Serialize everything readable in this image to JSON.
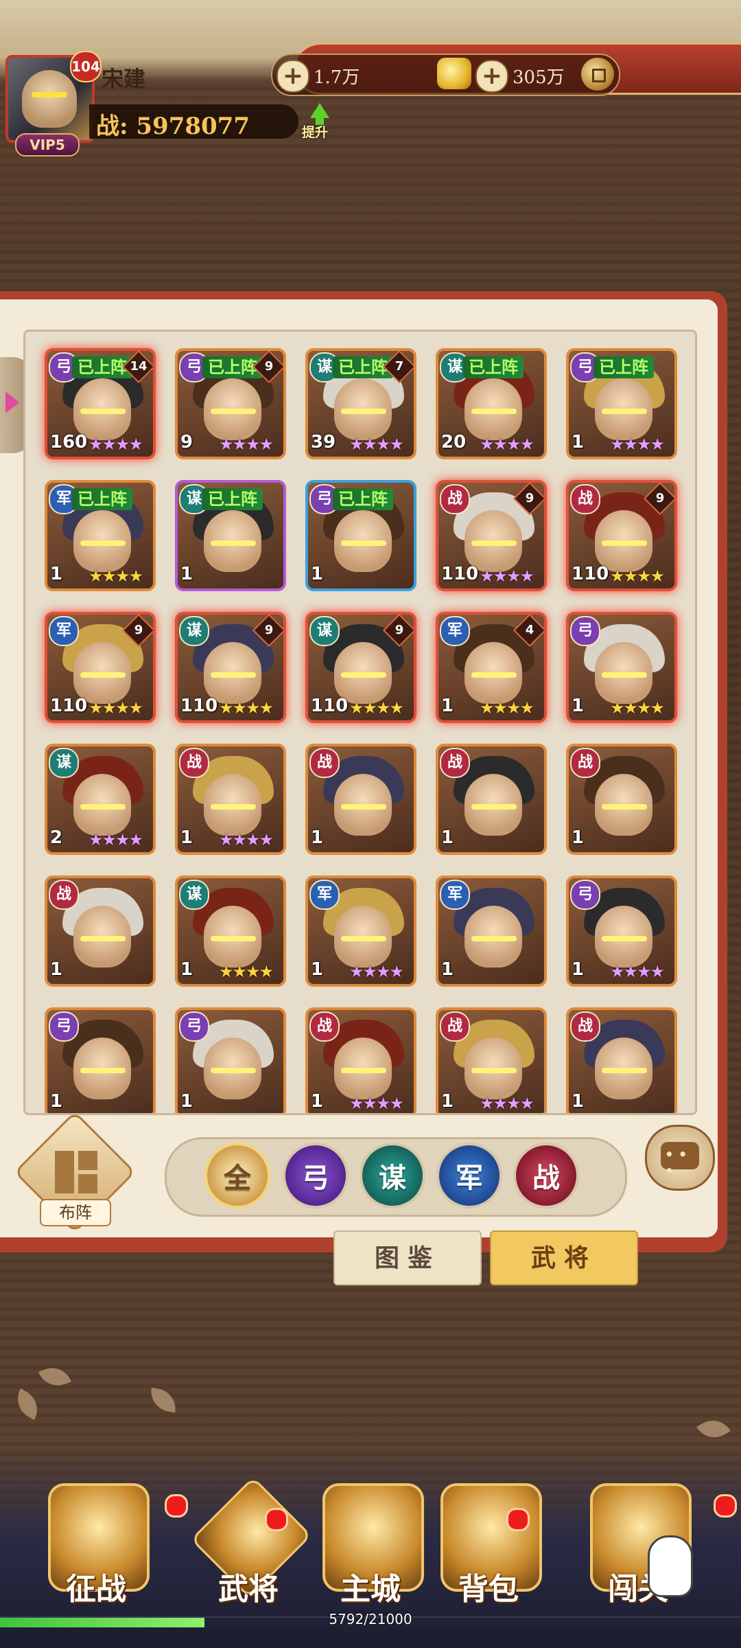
{
  "player": {
    "name": "宋建",
    "level": "104",
    "vip": "VIP5",
    "power": "战: 5978077",
    "upgrade_label": "提升"
  },
  "currency": {
    "gold_amount": "1.7万",
    "ingot_amount": "305万",
    "icons": [
      "plus-icon",
      "gold-ingot-icon",
      "plus-icon",
      "coin-icon"
    ]
  },
  "heroes": [
    {
      "class": "弓",
      "cls": "bow",
      "deployed": "已上阵",
      "rank": "14",
      "level": "160",
      "stars": "★★★★",
      "star_color": "purple",
      "rarity": "red"
    },
    {
      "class": "弓",
      "cls": "bow",
      "deployed": "已上阵",
      "rank": "9",
      "level": "9",
      "stars": "★★★★",
      "star_color": "purple",
      "rarity": "orange"
    },
    {
      "class": "谋",
      "cls": "plot",
      "deployed": "已上阵",
      "rank": "7",
      "level": "39",
      "stars": "★★★★",
      "star_color": "purple",
      "rarity": "orange"
    },
    {
      "class": "谋",
      "cls": "plot",
      "deployed": "已上阵",
      "rank": "",
      "level": "20",
      "stars": "★★★★",
      "star_color": "purple",
      "rarity": "orange"
    },
    {
      "class": "弓",
      "cls": "bow",
      "deployed": "已上阵",
      "rank": "",
      "level": "1",
      "stars": "★★★★",
      "star_color": "purple",
      "rarity": "orange"
    },
    {
      "class": "军",
      "cls": "army",
      "deployed": "已上阵",
      "rank": "",
      "level": "1",
      "stars": "★★★★",
      "star_color": "gold",
      "rarity": "orange"
    },
    {
      "class": "谋",
      "cls": "plot",
      "deployed": "已上阵",
      "rank": "",
      "level": "1",
      "stars": "",
      "star_color": "gold",
      "rarity": "purple"
    },
    {
      "class": "弓",
      "cls": "bow",
      "deployed": "已上阵",
      "rank": "",
      "level": "1",
      "stars": "",
      "star_color": "gold",
      "rarity": "blue"
    },
    {
      "class": "战",
      "cls": "war",
      "deployed": "",
      "rank": "9",
      "level": "110",
      "stars": "★★★★",
      "star_color": "purple",
      "rarity": "red"
    },
    {
      "class": "战",
      "cls": "war",
      "deployed": "",
      "rank": "9",
      "level": "110",
      "stars": "★★★★",
      "star_color": "gold",
      "rarity": "red"
    },
    {
      "class": "军",
      "cls": "army",
      "deployed": "",
      "rank": "9",
      "level": "110",
      "stars": "★★★★",
      "star_color": "gold",
      "rarity": "red"
    },
    {
      "class": "谋",
      "cls": "plot",
      "deployed": "",
      "rank": "9",
      "level": "110",
      "stars": "★★★★",
      "star_color": "gold",
      "rarity": "red"
    },
    {
      "class": "谋",
      "cls": "plot",
      "deployed": "",
      "rank": "9",
      "level": "110",
      "stars": "★★★★",
      "star_color": "gold",
      "rarity": "red"
    },
    {
      "class": "军",
      "cls": "army",
      "deployed": "",
      "rank": "4",
      "level": "1",
      "stars": "★★★★",
      "star_color": "gold",
      "rarity": "red"
    },
    {
      "class": "弓",
      "cls": "bow",
      "deployed": "",
      "rank": "",
      "level": "1",
      "stars": "★★★★",
      "star_color": "gold",
      "rarity": "red"
    },
    {
      "class": "谋",
      "cls": "plot",
      "deployed": "",
      "rank": "",
      "level": "2",
      "stars": "★★★★",
      "star_color": "purple",
      "rarity": "orange"
    },
    {
      "class": "战",
      "cls": "war",
      "deployed": "",
      "rank": "",
      "level": "1",
      "stars": "★★★★",
      "star_color": "purple",
      "rarity": "orange"
    },
    {
      "class": "战",
      "cls": "war",
      "deployed": "",
      "rank": "",
      "level": "1",
      "stars": "",
      "star_color": "gold",
      "rarity": "orange"
    },
    {
      "class": "战",
      "cls": "war",
      "deployed": "",
      "rank": "",
      "level": "1",
      "stars": "",
      "star_color": "gold",
      "rarity": "orange"
    },
    {
      "class": "战",
      "cls": "war",
      "deployed": "",
      "rank": "",
      "level": "1",
      "stars": "",
      "star_color": "gold",
      "rarity": "orange"
    },
    {
      "class": "战",
      "cls": "war",
      "deployed": "",
      "rank": "",
      "level": "1",
      "stars": "",
      "star_color": "gold",
      "rarity": "orange"
    },
    {
      "class": "谋",
      "cls": "plot",
      "deployed": "",
      "rank": "",
      "level": "1",
      "stars": "★★★★",
      "star_color": "gold",
      "rarity": "orange"
    },
    {
      "class": "军",
      "cls": "army",
      "deployed": "",
      "rank": "",
      "level": "1",
      "stars": "★★★★",
      "star_color": "purple",
      "rarity": "orange"
    },
    {
      "class": "军",
      "cls": "army",
      "deployed": "",
      "rank": "",
      "level": "1",
      "stars": "",
      "star_color": "gold",
      "rarity": "orange"
    },
    {
      "class": "弓",
      "cls": "bow",
      "deployed": "",
      "rank": "",
      "level": "1",
      "stars": "★★★★",
      "star_color": "purple",
      "rarity": "orange"
    },
    {
      "class": "弓",
      "cls": "bow",
      "deployed": "",
      "rank": "",
      "level": "1",
      "stars": "",
      "star_color": "gold",
      "rarity": "orange"
    },
    {
      "class": "弓",
      "cls": "bow",
      "deployed": "",
      "rank": "",
      "level": "1",
      "stars": "",
      "star_color": "gold",
      "rarity": "orange"
    },
    {
      "class": "战",
      "cls": "war",
      "deployed": "",
      "rank": "",
      "level": "1",
      "stars": "★★★★",
      "star_color": "purple",
      "rarity": "orange"
    },
    {
      "class": "战",
      "cls": "war",
      "deployed": "",
      "rank": "",
      "level": "1",
      "stars": "★★★★",
      "star_color": "purple",
      "rarity": "orange"
    },
    {
      "class": "战",
      "cls": "war",
      "deployed": "",
      "rank": "",
      "level": "1",
      "stars": "",
      "star_color": "gold",
      "rarity": "orange"
    }
  ],
  "controls": {
    "formation_label": "布阵",
    "filters": [
      "全",
      "弓",
      "谋",
      "军",
      "战"
    ],
    "chat_icon": "chat-icon"
  },
  "tabs": {
    "codex": "图鉴",
    "generals": "武将"
  },
  "nav": {
    "items": [
      {
        "label": "征战",
        "icon": "campaign-icon",
        "badge": true
      },
      {
        "label": "武将",
        "icon": "helmet-icon",
        "badge": true
      },
      {
        "label": "主城",
        "icon": "castle-icon",
        "badge": false
      },
      {
        "label": "背包",
        "icon": "bag-icon",
        "badge": true
      },
      {
        "label": "闯关",
        "icon": "drum-icon",
        "badge": true
      }
    ],
    "exp_text": "5792/21000",
    "exp_fraction": 0.2758
  },
  "colors": {
    "panel_border": "#b0402e",
    "panel_bg": "#f3ead8",
    "deployed_text": "#b6ff6a",
    "power_text": "#f8c35a"
  }
}
